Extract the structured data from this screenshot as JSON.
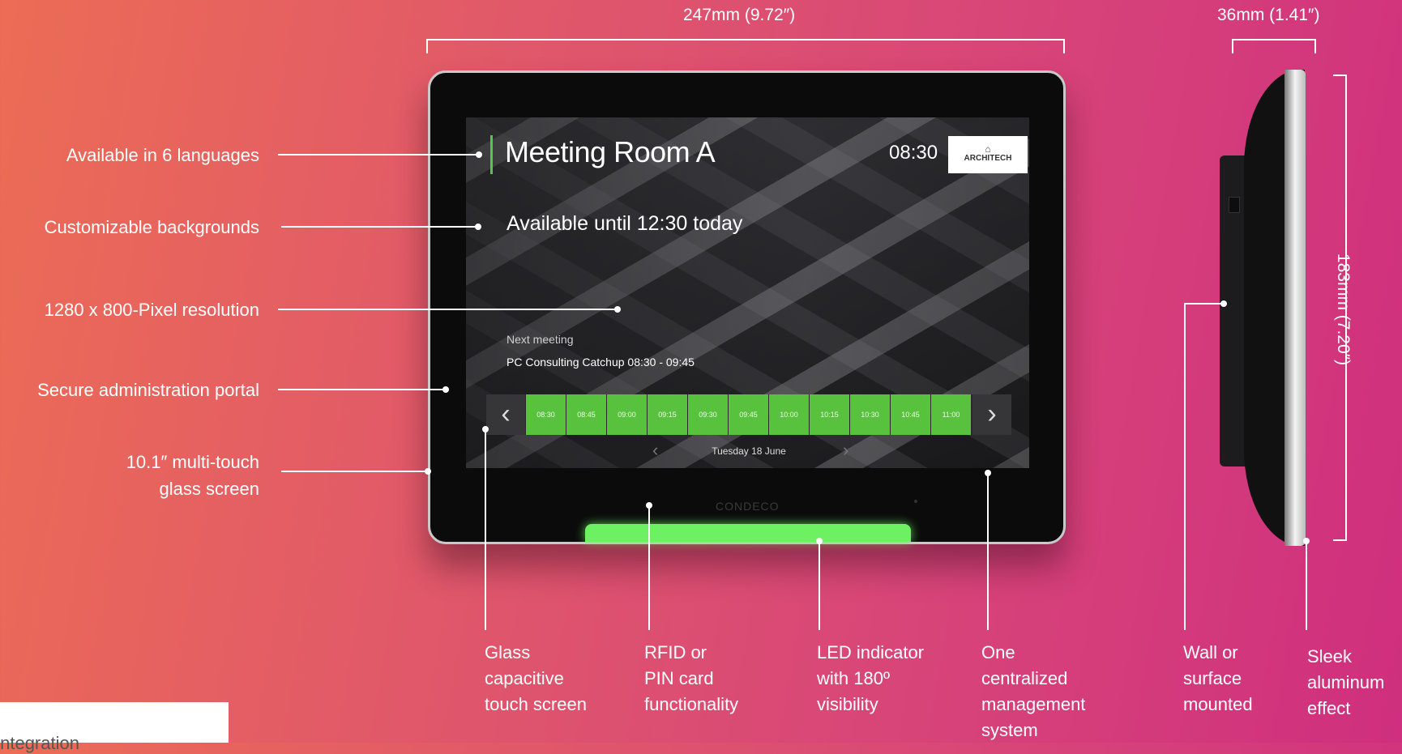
{
  "dimensions": {
    "width_label": "247mm (9.72″)",
    "depth_label": "36mm (1.41″)",
    "height_label": "183mm (7.20″)"
  },
  "left_features": [
    "Available in 6 languages",
    "Customizable backgrounds",
    "1280 x 800-Pixel resolution",
    "Secure administration portal",
    "10.1″ multi-touch",
    "glass screen"
  ],
  "bottom_features": {
    "glass": [
      "Glass",
      "capacitive",
      "touch screen"
    ],
    "rfid": [
      "RFID or",
      "PIN card",
      "functionality"
    ],
    "led": [
      "LED indicator",
      "with 180º",
      "visibility"
    ],
    "central": [
      "One",
      "centralized",
      "management",
      "system"
    ],
    "wall": [
      "Wall or",
      "surface",
      "mounted"
    ],
    "sleek": [
      "Sleek",
      "aluminum",
      "effect"
    ]
  },
  "screen": {
    "room_title": "Meeting Room A",
    "time": "08:30",
    "logo_text": "ARCHITECH",
    "logo_mark": "⌂",
    "availability": "Available until 12:30 today",
    "next_label": "Next meeting",
    "next_meeting": "PC Consulting Catchup  08:30 - 09:45",
    "time_slots": [
      "08:30",
      "08:45",
      "09:00",
      "09:15",
      "09:30",
      "09:45",
      "10:00",
      "10:15",
      "10:30",
      "10:45",
      "11:00"
    ],
    "date": "Tuesday 18 June",
    "slot_color": "#58c23f"
  },
  "brand": "CONDECO",
  "led_color": "#6df062",
  "card_text": "Integration"
}
